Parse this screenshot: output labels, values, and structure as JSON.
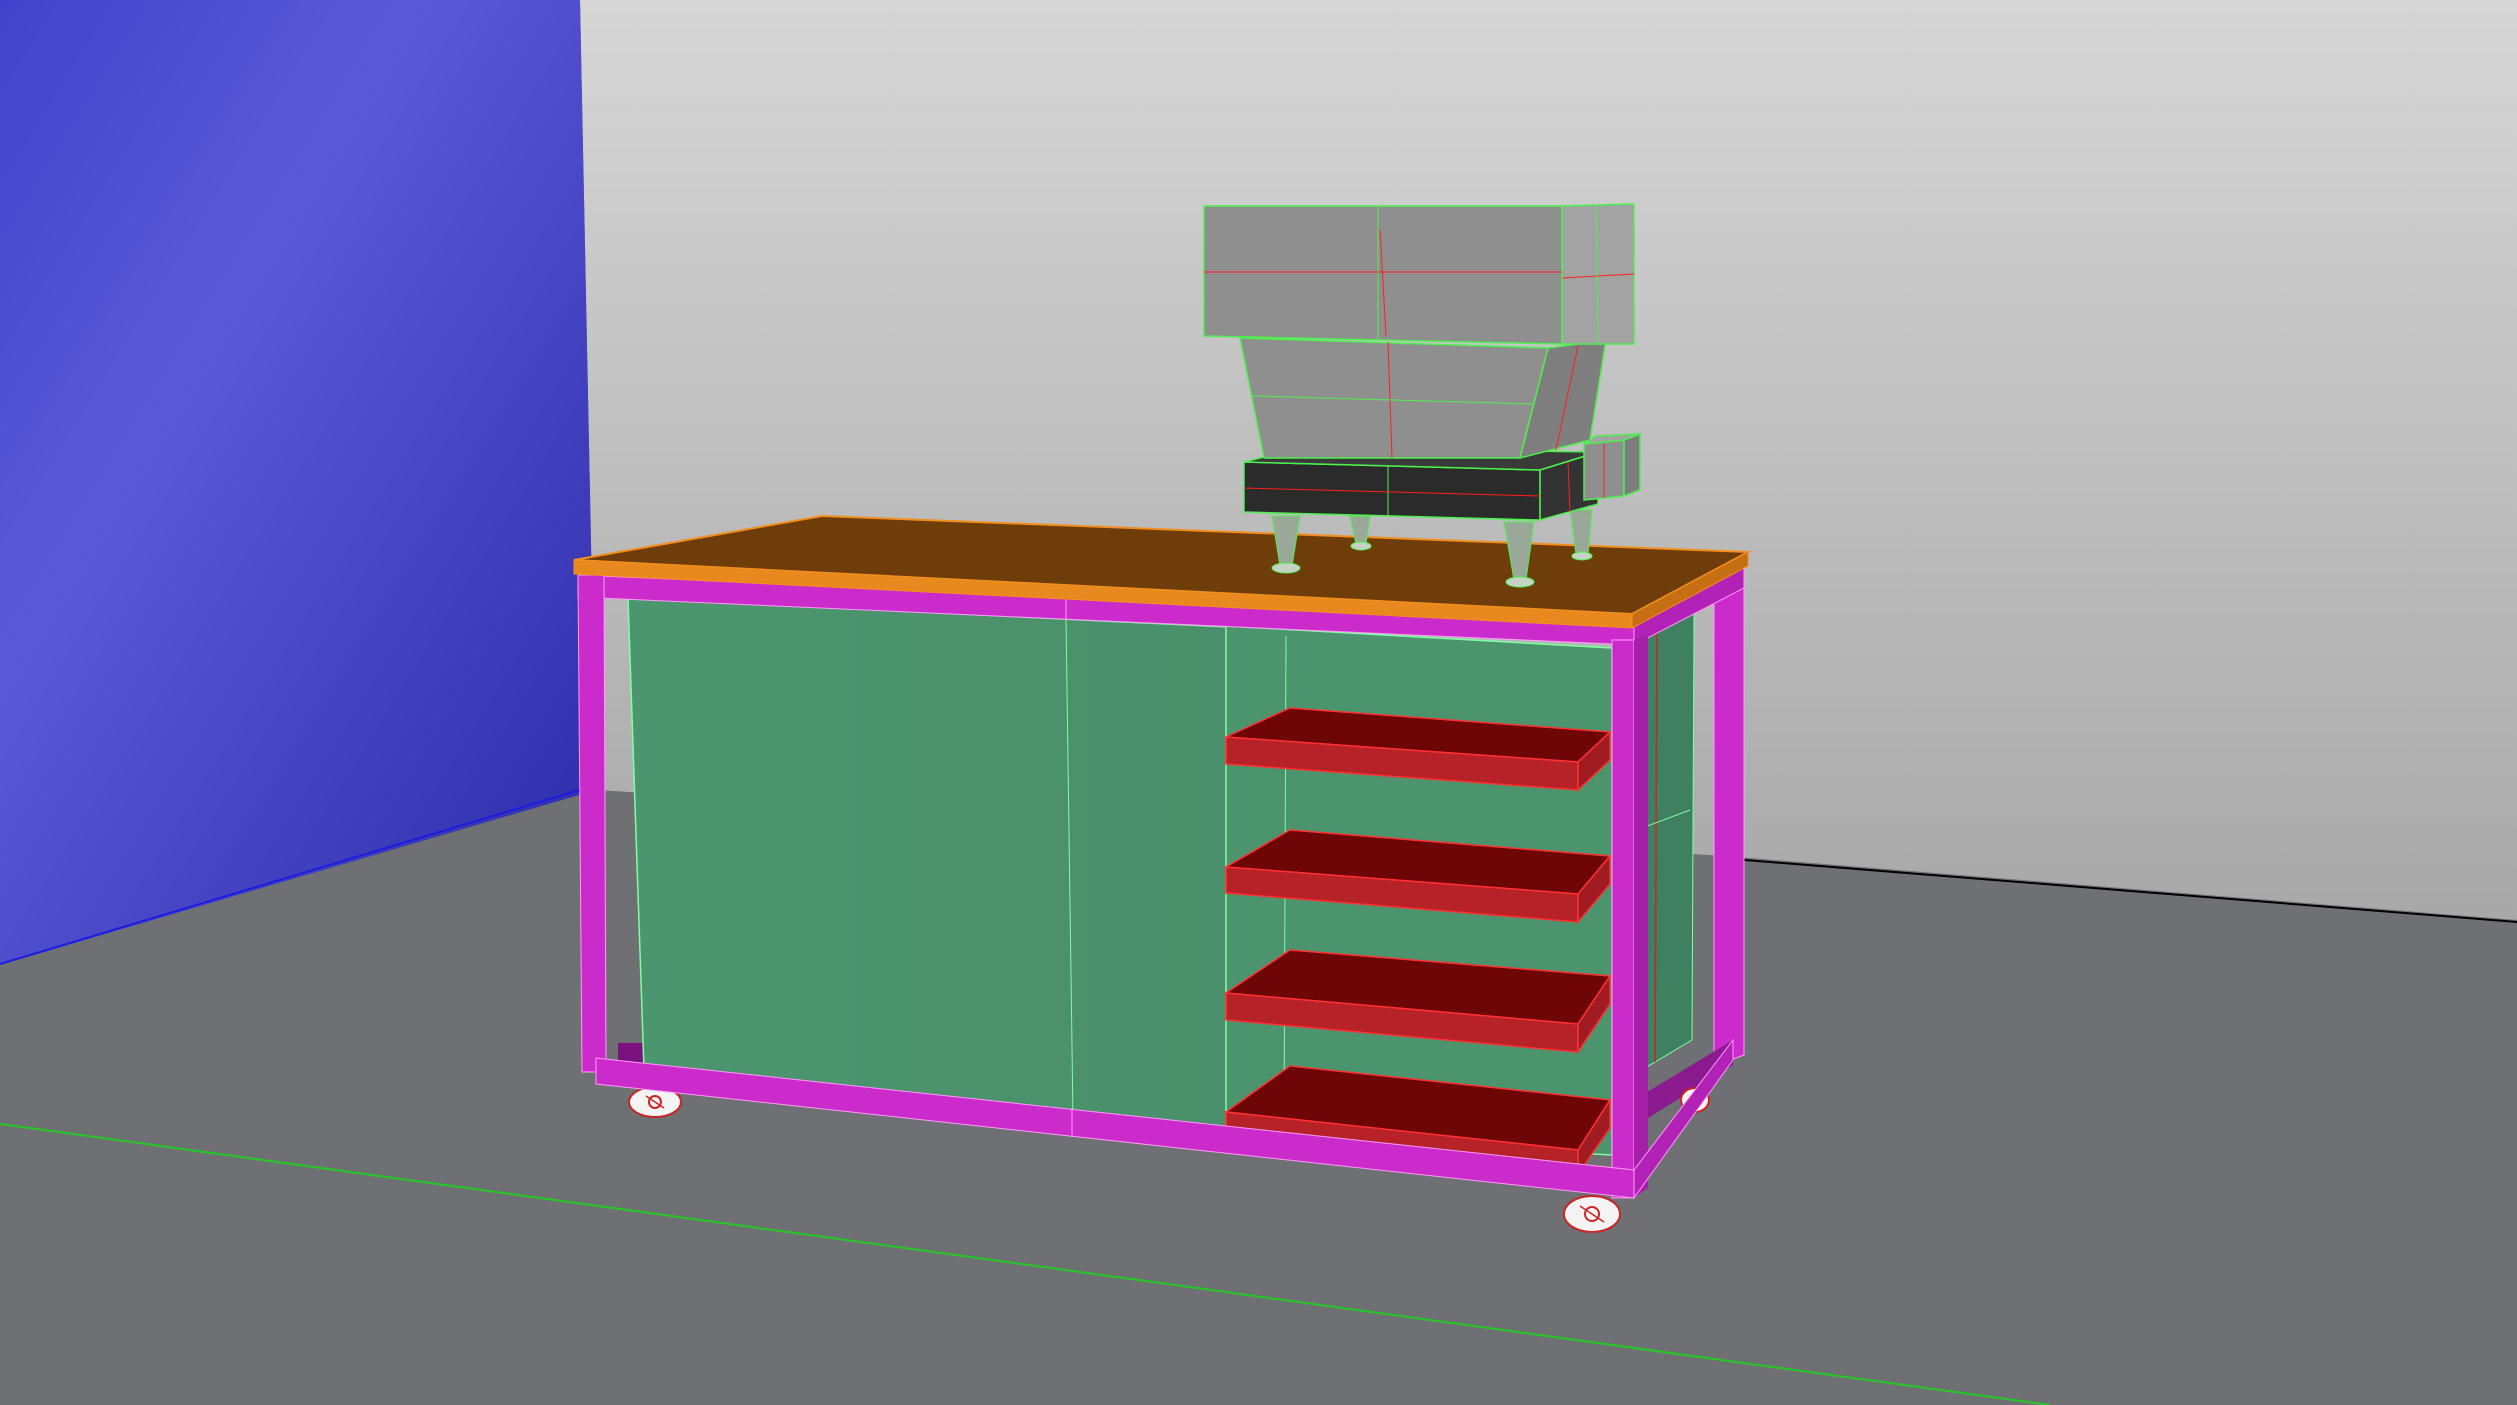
{
  "viewport": {
    "colors": {
      "back_wall_top": "#d6d6d6",
      "back_wall_bottom": "#a8a8a8",
      "side_wall_light": "#5757d8",
      "side_wall_dark": "#2f2fb0",
      "floor": "#6f7074",
      "ground_axis_line": "#25c925",
      "selection_edge_green": "#4ef04e",
      "selection_edge_red": "#ff1f1f"
    }
  },
  "scene": {
    "workbench": {
      "top_color": "#6e3d0a",
      "top_edge_color": "#f28e1e",
      "frame_color": "#cc2bcc",
      "frame_dark_color": "#8a1a8e",
      "panel_color": "#4a916c",
      "panel_side_color": "#3e8060",
      "shelf_color": "#6e0507",
      "shelf_front_color": "#b72228",
      "shelf_count": 4,
      "caster_count": 4
    },
    "machine": {
      "hopper_color": "#8f8f8f",
      "hopper_light_color": "#a3a3a3",
      "base_color": "#2b2b2b",
      "leg_color": "#9aa89a",
      "leg_count": 4
    }
  }
}
